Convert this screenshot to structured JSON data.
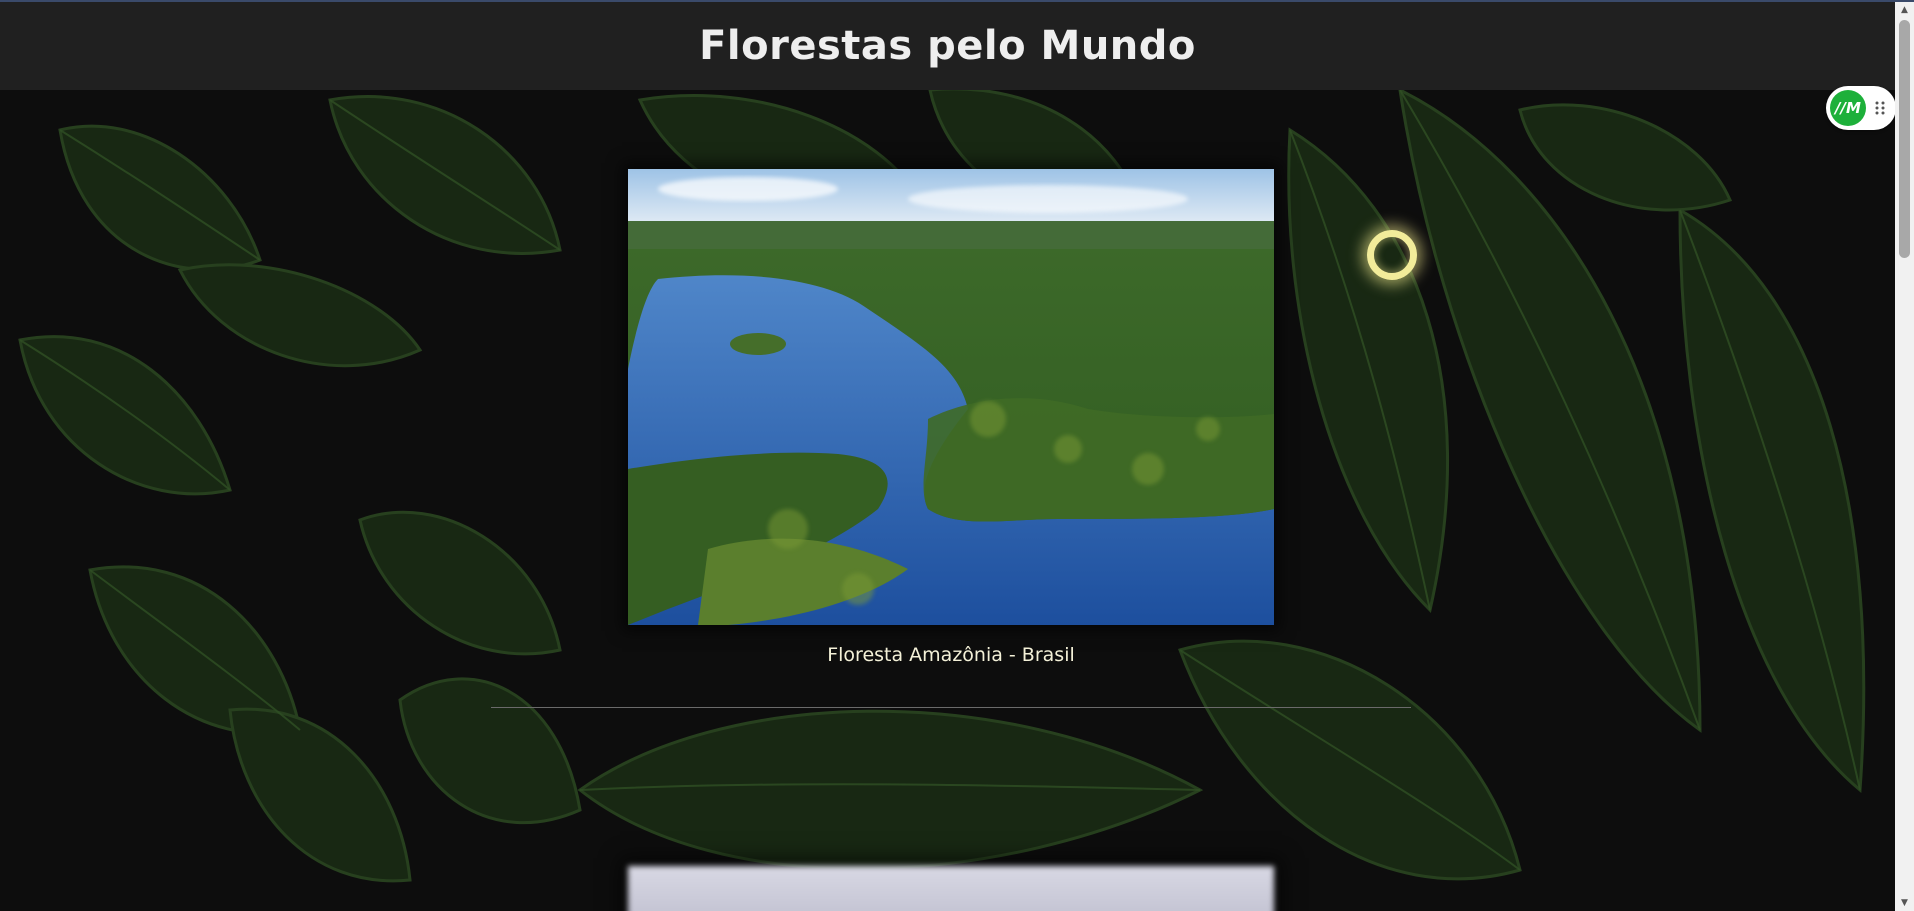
{
  "header": {
    "title": "Florestas pelo Mundo"
  },
  "gallery": {
    "items": [
      {
        "caption": "Floresta Amazônia - Brasil"
      }
    ]
  },
  "extension": {
    "logo_text": "//M",
    "icon": "drag-handle-icon"
  },
  "colors": {
    "page_bg": "#0d0d0d",
    "header_bg": "#202020",
    "title_text": "#eeeeee",
    "caption_text": "#f4f1d8",
    "leaf_green": "#1f3418",
    "extension_green": "#1db03a",
    "cursor_ring": "#f2ec9a"
  }
}
